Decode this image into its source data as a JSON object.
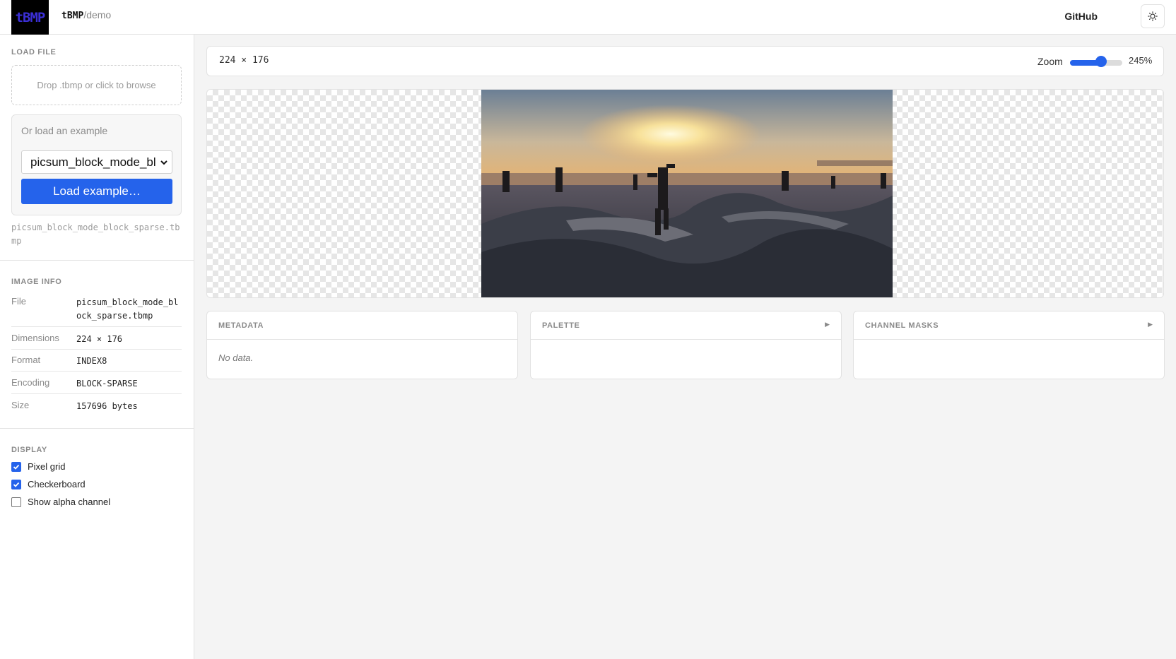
{
  "header": {
    "logo_text": "tBMP",
    "brand_name": "tBMP",
    "brand_sub": "/demo",
    "github_label": "GitHub",
    "theme_icon": "sun-icon"
  },
  "sidebar": {
    "load_file": {
      "title": "LOAD FILE",
      "dropzone_text": "Drop .tbmp or click to browse",
      "example_label": "Or load an example",
      "example_selected": "picsum_block_mode_bl",
      "load_button": "Load example…",
      "loaded_filename": "picsum_block_mode_block_sparse.tbmp"
    },
    "image_info": {
      "title": "IMAGE INFO",
      "rows": [
        {
          "key": "File",
          "value": "picsum_block_mode_block_sparse.tbmp"
        },
        {
          "key": "Dimensions",
          "value": "224 × 176"
        },
        {
          "key": "Format",
          "value": "INDEX8"
        },
        {
          "key": "Encoding",
          "value": "BLOCK-SPARSE"
        },
        {
          "key": "Size",
          "value": "157696 bytes"
        }
      ]
    },
    "display": {
      "title": "DISPLAY",
      "options": [
        {
          "label": "Pixel grid",
          "checked": true
        },
        {
          "label": "Checkerboard",
          "checked": true
        },
        {
          "label": "Show alpha channel",
          "checked": false
        }
      ]
    }
  },
  "main": {
    "toolbar": {
      "dimensions": "224 × 176",
      "zoom_label": "Zoom",
      "zoom_value": "245%",
      "zoom_slider_fraction": 0.6
    },
    "panels": [
      {
        "title": "METADATA",
        "body": "No data.",
        "collapsible": false
      },
      {
        "title": "PALETTE",
        "body": "",
        "collapsible": true
      },
      {
        "title": "CHANNEL MASKS",
        "body": "",
        "collapsible": true
      }
    ]
  },
  "colors": {
    "accent": "#2563eb",
    "logo_bg": "#000000",
    "logo_text": "#3b2fd6"
  }
}
